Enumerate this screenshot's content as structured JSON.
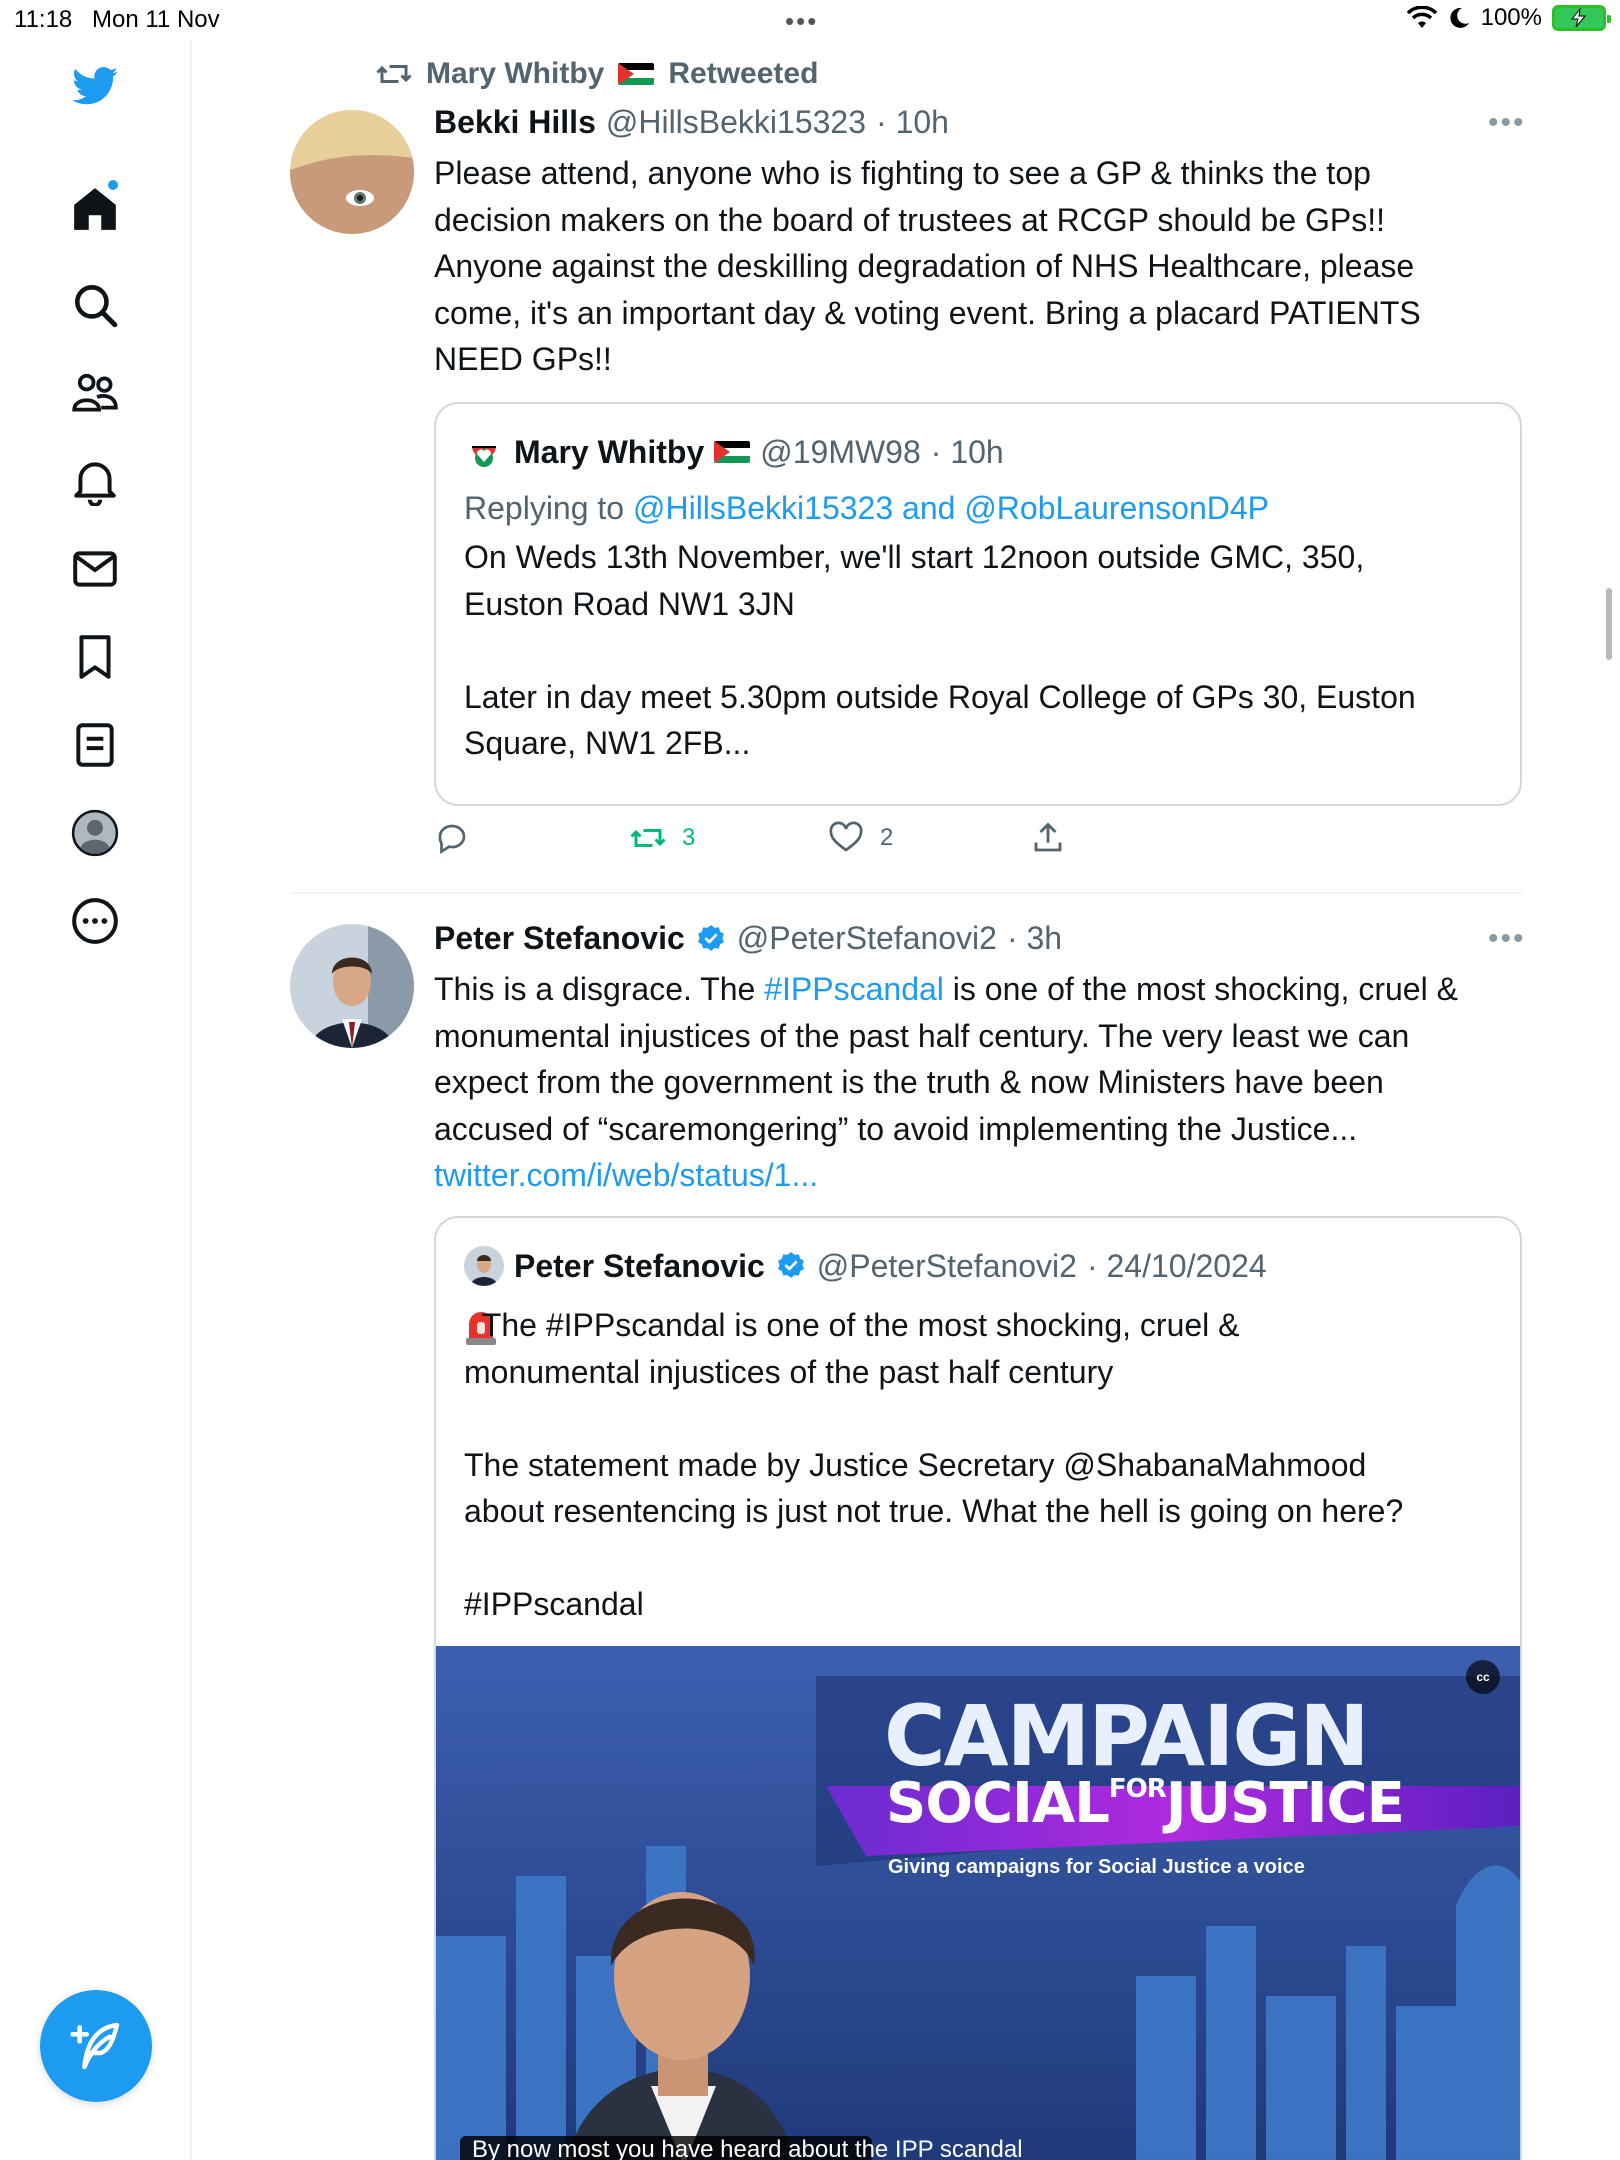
{
  "status_bar": {
    "time": "11:18",
    "date": "Mon 11 Nov",
    "battery": "100%"
  },
  "sidebar": {
    "items": [
      "twitter-logo",
      "home",
      "search",
      "communities",
      "notifications",
      "messages",
      "bookmarks",
      "lists",
      "profile",
      "more"
    ]
  },
  "tweet1": {
    "retweeted_by": "Mary Whitby",
    "retweeted_label": "Retweeted",
    "name": "Bekki Hills",
    "handle": "@HillsBekki15323",
    "time": "· 10h",
    "text": "Please attend, anyone who is fighting to see a GP & thinks the top\ndecision makers on the board of trustees at RCGP should be GPs!!\nAnyone against the deskilling degradation of NHS Healthcare, please\ncome, it's an important day & voting event. Bring a placard PATIENTS\nNEED GPs!!",
    "quote": {
      "name": "Mary Whitby",
      "handle": "@19MW98",
      "time": "· 10h",
      "replying_to_label": "Replying to",
      "replying_to": "@HillsBekki15323 and @RobLaurensonD4P",
      "text": "On Weds 13th November, we'll start 12noon outside GMC, 350,\nEuston Road NW1 3JN\n\nLater in day meet 5.30pm outside Royal College of GPs 30, Euston\nSquare, NW1 2FB..."
    },
    "retweets": "3",
    "likes": "2"
  },
  "tweet2": {
    "name": "Peter Stefanovic",
    "handle": "@PeterStefanovi2",
    "time": "· 3h",
    "text_before": "This is a disgrace. The ",
    "hashtag": "#IPPscandal",
    "text_after": " is one of the most shocking, cruel &\nmonumental injustices of the past half century. The very least we can\nexpect from the government is the truth & now Ministers have been\naccused of “scaremongering” to avoid implementing the Justice...\n",
    "link": "twitter.com/i/web/status/1...",
    "quote": {
      "name": "Peter Stefanovic",
      "handle": "@PeterStefanovi2",
      "time": "· 24/10/2024",
      "text": "  The #IPPscandal is one of the most shocking, cruel &\nmonumental injustices of the past half century\n\nThe statement made by Justice Secretary @ShabanaMahmood\nabout resentencing is just not true. What the hell is going on here?\n\n#IPPscandal",
      "media": {
        "banner_line1": "CAMPAIGN",
        "banner_line2a": "SOCIAL",
        "banner_line2b": "FOR",
        "banner_line2c": "JUSTICE",
        "banner_tagline": "Giving campaigns for Social Justice a voice",
        "cc_label": "cc",
        "caption": "By now most you have heard about the IPP scandal"
      }
    }
  },
  "colors": {
    "accent": "#1d9bf0",
    "retweet_green": "#00ba7c",
    "muted": "#536471",
    "border": "#cfd9de"
  }
}
